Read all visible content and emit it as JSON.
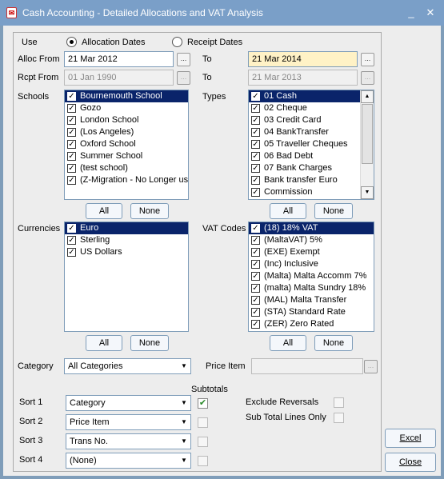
{
  "window": {
    "title": "Cash Accounting - Detailed Allocations and VAT Analysis",
    "icon": "app-icon"
  },
  "use": {
    "label": "Use",
    "option1": "Allocation Dates",
    "option2": "Receipt Dates",
    "selected": "Allocation Dates"
  },
  "alloc": {
    "from_label": "Alloc From",
    "from_value": "21 Mar 2012",
    "to_label": "To",
    "to_value": "21 Mar 2014"
  },
  "rcpt": {
    "from_label": "Rcpt From",
    "from_value": "01 Jan 1990",
    "to_label": "To",
    "to_value": "21 Mar 2013"
  },
  "ellipsis": "...",
  "schools": {
    "label": "Schools",
    "items": [
      {
        "label": "Bournemouth School",
        "checked": true,
        "selected": true
      },
      {
        "label": "Gozo",
        "checked": true
      },
      {
        "label": "London School",
        "checked": true
      },
      {
        "label": "(Los Angeles)",
        "checked": true
      },
      {
        "label": "Oxford School",
        "checked": true
      },
      {
        "label": "Summer School",
        "checked": true
      },
      {
        "label": "(test school)",
        "checked": true
      },
      {
        "label": "(Z-Migration - No Longer use",
        "checked": true
      }
    ],
    "all": "All",
    "none": "None"
  },
  "types": {
    "label": "Types",
    "items": [
      {
        "label": "01 Cash",
        "checked": true,
        "selected": true
      },
      {
        "label": "02 Cheque",
        "checked": true
      },
      {
        "label": "03 Credit Card",
        "checked": true
      },
      {
        "label": "04 BankTransfer",
        "checked": true
      },
      {
        "label": "05 Traveller Cheques",
        "checked": true
      },
      {
        "label": "06 Bad Debt",
        "checked": true
      },
      {
        "label": "07 Bank Charges",
        "checked": true
      },
      {
        "label": "Bank transfer Euro",
        "checked": true
      },
      {
        "label": "Commission",
        "checked": true
      }
    ],
    "all": "All",
    "none": "None"
  },
  "currencies": {
    "label": "Currencies",
    "items": [
      {
        "label": "Euro",
        "checked": true,
        "selected": true
      },
      {
        "label": "Sterling",
        "checked": true
      },
      {
        "label": "US Dollars",
        "checked": true
      }
    ],
    "all": "All",
    "none": "None"
  },
  "vat": {
    "label": "VAT Codes",
    "items": [
      {
        "label": "(18) 18% VAT",
        "checked": true,
        "selected": true
      },
      {
        "label": "(MaltaVAT) 5%",
        "checked": true
      },
      {
        "label": "(EXE) Exempt",
        "checked": true
      },
      {
        "label": "(Inc) Inclusive",
        "checked": true
      },
      {
        "label": "(Malta) Malta Accomm 7%",
        "checked": true
      },
      {
        "label": "(malta) Malta Sundry 18%",
        "checked": true
      },
      {
        "label": "(MAL) Malta Transfer",
        "checked": true
      },
      {
        "label": "(STA) Standard Rate",
        "checked": true
      },
      {
        "label": "(ZER) Zero Rated",
        "checked": true
      }
    ],
    "all": "All",
    "none": "None"
  },
  "category": {
    "label": "Category",
    "value": "All Categories"
  },
  "price_item": {
    "label": "Price Item",
    "value": ""
  },
  "subtotals_label": "Subtotals",
  "sorts": [
    {
      "label": "Sort 1",
      "value": "Category",
      "subtotal": true
    },
    {
      "label": "Sort 2",
      "value": "Price Item",
      "subtotal": false
    },
    {
      "label": "Sort 3",
      "value": "Trans No.",
      "subtotal": false
    },
    {
      "label": "Sort 4",
      "value": "(None)",
      "subtotal": false
    }
  ],
  "options": {
    "exclude_reversals": "Exclude Reversals",
    "sub_total_lines_only": "Sub Total Lines Only"
  },
  "buttons": {
    "excel": "Excel",
    "close": "Close"
  },
  "check_glyph": "✔",
  "tick": "✓"
}
